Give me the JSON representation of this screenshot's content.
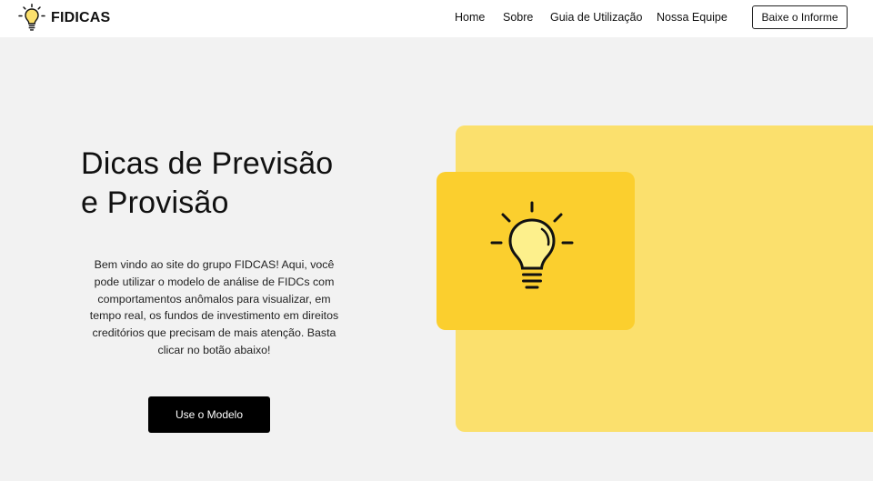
{
  "nav": {
    "brand": "FIDICAS",
    "logo_icon": "lightbulb-icon",
    "links": [
      "Home",
      "Sobre",
      "Guia de Utilização",
      "Nossa Equipe"
    ],
    "cta": "Baixe o Informe"
  },
  "hero": {
    "title_line1": "Dicas de Previsão",
    "title_line2": "e Provisão",
    "description": "Bem vindo ao site do grupo FIDCAS! Aqui, você pode utilizar o modelo de análise de FIDCs com comportamentos anômalos para visualizar, em tempo real, os fundos de investimento em direitos creditórios que precisam de mais atenção. Basta clicar no botão abaixo!",
    "button": "Use o Modelo"
  },
  "illustration": {
    "icon": "lightbulb-icon"
  },
  "colors": {
    "page_bg": "#f2f2f2",
    "panel_yellow": "#fbe06d",
    "card_yellow": "#fbcf2e",
    "bulb_fill": "#fdf08c",
    "button_bg": "#000000"
  }
}
